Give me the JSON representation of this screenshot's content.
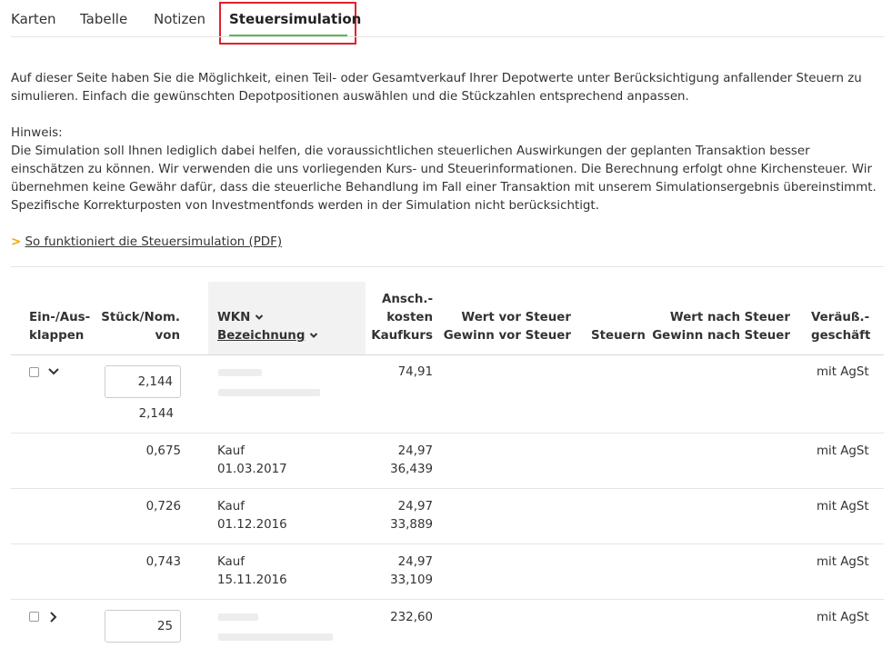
{
  "tabs": [
    {
      "label": "Karten"
    },
    {
      "label": "Tabelle"
    },
    {
      "label": "Notizen"
    },
    {
      "label": "Steuersimulation"
    }
  ],
  "intro": {
    "text": "Auf dieser Seite haben Sie die Möglichkeit, einen Teil- oder Gesamtverkauf Ihrer Depotwerte unter Berücksichtigung anfallender Steuern zu simulieren. Einfach die gewünschten Depotpositionen auswählen und die Stückzahlen entsprechend anpassen.",
    "hint_title": "Hinweis:",
    "hint_text": "Die Simulation soll Ihnen lediglich dabei helfen, die voraussichtlichen steuerlichen Auswirkungen der geplanten Transaktion besser einschätzen zu können. Wir verwenden die uns vorliegenden Kurs- und Steuerinformationen. Die Berechnung erfolgt ohne Kirchensteuer. Wir übernehmen keine Gewähr dafür, dass die steuerliche Behandlung im Fall einer Transaktion mit unserem Simulationsergebnis übereinstimmt. Spezifische Korrekturposten von Investmentfonds werden in der Simulation nicht berücksichtigt.",
    "link_arrow": ">",
    "link_label": "So funktioniert die Steuersimulation (PDF)"
  },
  "table": {
    "headers": {
      "expand": [
        "Ein-/Aus-",
        "klappen"
      ],
      "qty": [
        "Stück/Nom.",
        "von"
      ],
      "wkn": "WKN",
      "name": "Bezeichnung",
      "cost": [
        "Ansch.-",
        "kosten",
        "Kaufkurs"
      ],
      "value": [
        "Wert vor Steuer",
        "Gewinn vor Steuer"
      ],
      "taxes": "Steuern",
      "after": [
        "Wert nach Steuer",
        "Gewinn nach Steuer"
      ],
      "sale": [
        "Veräuß.-",
        "geschäft"
      ]
    },
    "position1": {
      "qty_input": "2,144",
      "qty_total": "2,144",
      "cost": "74,91",
      "sale": "mit AgSt"
    },
    "lots": [
      {
        "qty": "0,675",
        "type": "Kauf",
        "date": "01.03.2017",
        "cost": "24,97",
        "rate": "36,439",
        "sale": "mit AgSt"
      },
      {
        "qty": "0,726",
        "type": "Kauf",
        "date": "01.12.2016",
        "cost": "24,97",
        "rate": "33,889",
        "sale": "mit AgSt"
      },
      {
        "qty": "0,743",
        "type": "Kauf",
        "date": "15.11.2016",
        "cost": "24,97",
        "rate": "33,109",
        "sale": "mit AgSt"
      }
    ],
    "position2": {
      "qty_input": "25",
      "cost": "232,60",
      "sale": "mit AgSt"
    }
  },
  "colors": {
    "active_tab_underline": "#5cb85c",
    "highlight_box": "#e0212b",
    "link_arrow": "#f0a500",
    "header_shade": "#f2f2f2"
  },
  "icons": [
    "chevron-down-icon",
    "chevron-right-icon",
    "sort-chevron-icon"
  ]
}
